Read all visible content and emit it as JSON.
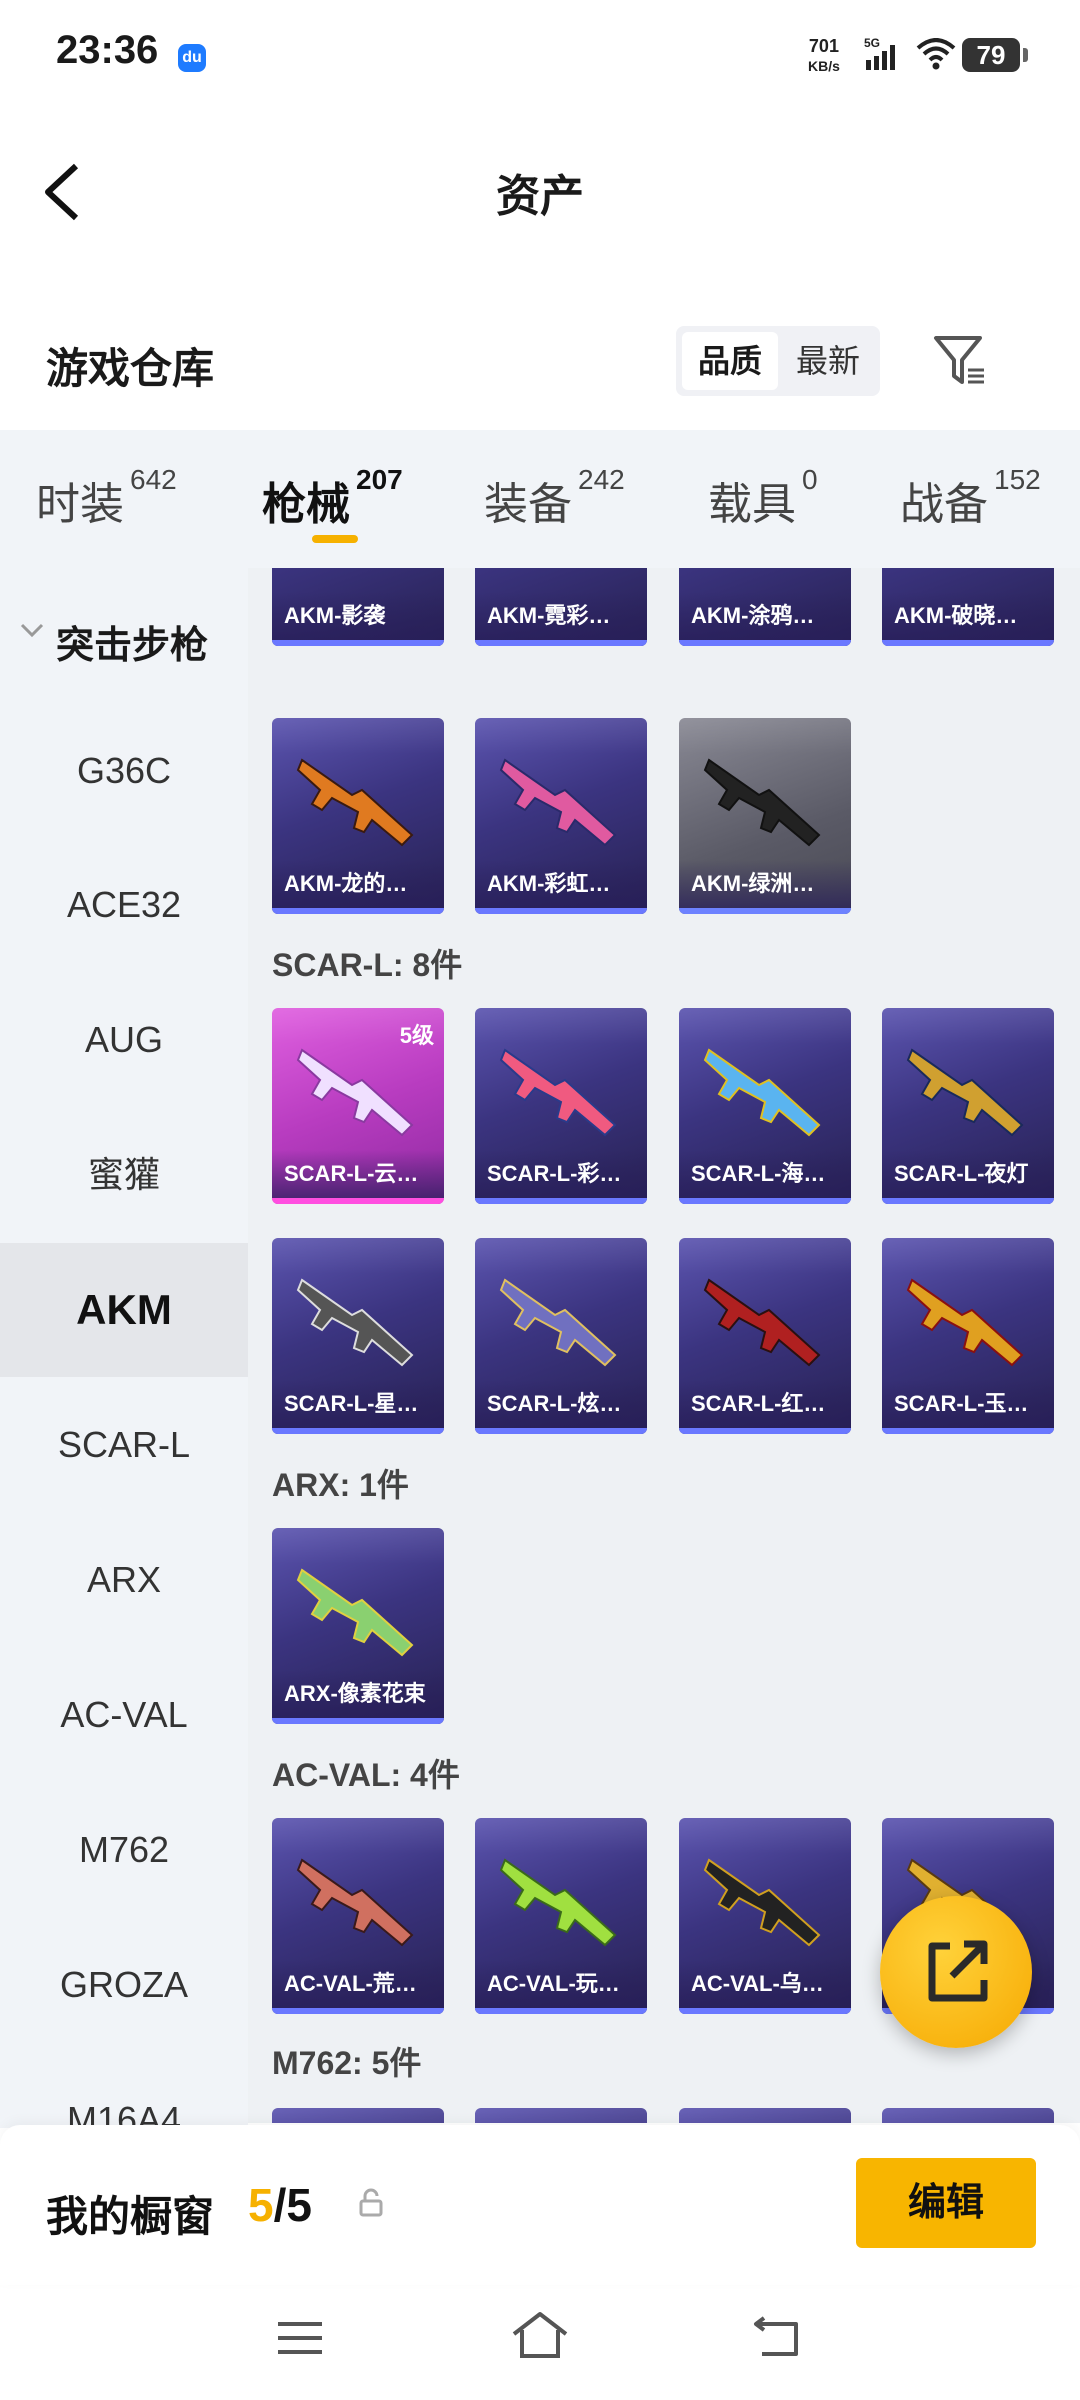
{
  "status_bar": {
    "time": "23:36",
    "app_icon_text": "du",
    "net_speed_value": "701",
    "net_speed_unit": "KB/s",
    "network_type": "5G",
    "battery_level": "79"
  },
  "header": {
    "title": "资产",
    "back_icon": "chevron-left-icon"
  },
  "toolbar": {
    "section_title": "游戏仓库",
    "sort_options": [
      "品质",
      "最新"
    ],
    "selected_sort": "品质",
    "filter_icon": "filter-icon"
  },
  "tabs": [
    {
      "label": "时装",
      "count": "642"
    },
    {
      "label": "枪械",
      "count": "207"
    },
    {
      "label": "装备",
      "count": "242"
    },
    {
      "label": "载具",
      "count": "0"
    },
    {
      "label": "战备",
      "count": "152"
    }
  ],
  "active_tab": "枪械",
  "sidebar": {
    "header": "突击步枪",
    "items": [
      "G36C",
      "ACE32",
      "AUG",
      "蜜獾",
      "AKM",
      "SCAR-L",
      "ARX",
      "AC-VAL",
      "M762",
      "GROZA",
      "M16A4"
    ],
    "active": "AKM"
  },
  "content": {
    "akm_row1": [
      "AKM-影袭",
      "AKM-霓彩…",
      "AKM-涂鸦…",
      "AKM-破晓…"
    ],
    "akm_row2": [
      "AKM-龙的…",
      "AKM-彩虹…",
      "AKM-绿洲…"
    ],
    "scar_title": "SCAR-L: 8件",
    "scar_row1": [
      "SCAR-L-云…",
      "SCAR-L-彩…",
      "SCAR-L-海…",
      "SCAR-L-夜灯"
    ],
    "scar_row2": [
      "SCAR-L-星…",
      "SCAR-L-炫…",
      "SCAR-L-红…",
      "SCAR-L-玉…"
    ],
    "scar_level_badge": "5级",
    "arx_title": "ARX: 1件",
    "arx_row": [
      "ARX-像素花束"
    ],
    "acval_title": "AC-VAL: 4件",
    "acval_row": [
      "AC-VAL-荒…",
      "AC-VAL-玩…",
      "AC-VAL-乌…",
      ""
    ],
    "m762_title": "M762: 5件"
  },
  "fab_icon": "share-external-icon",
  "showcase": {
    "label": "我的橱窗",
    "used": "5",
    "separator_total": "/5",
    "lock_icon": "lock-icon",
    "edit_label": "编辑"
  },
  "nav_bar": {
    "menu_icon": "menu-icon",
    "home_icon": "home-icon",
    "back_icon": "back-icon"
  },
  "colors": {
    "accent": "#f6b100",
    "card_purple": "#3b3480",
    "card_pink": "#b83cc0",
    "tab_bg": "#f1f4f8"
  }
}
